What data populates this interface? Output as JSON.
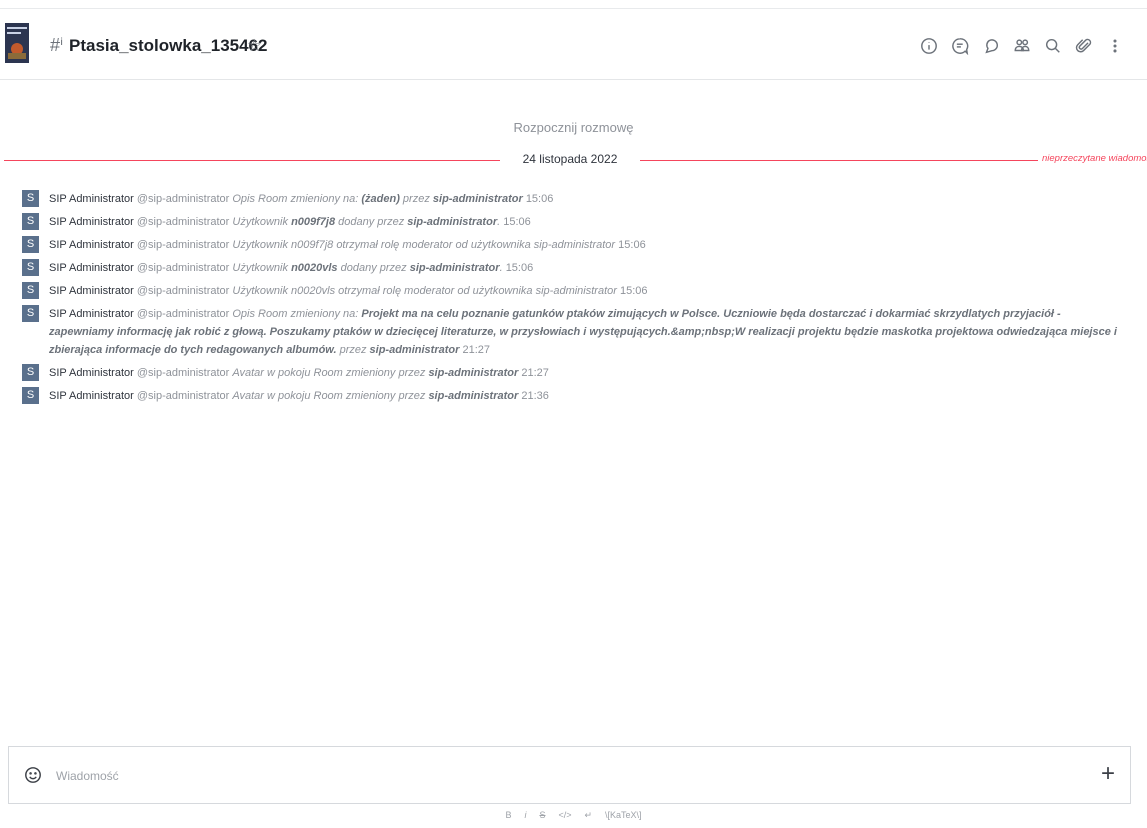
{
  "room": {
    "hash_icon": "#ⁱ",
    "name": "Ptasia_stolowka_135462",
    "star_icon": "☆"
  },
  "toolbar_icons": [
    "info-icon",
    "threads-icon",
    "discussion-icon",
    "members-icon",
    "search-icon",
    "attachment-icon",
    "kebab-icon"
  ],
  "start_conversation": "Rozpocznij rozmowę",
  "divider": {
    "date": "24 listopada 2022",
    "unread": "nieprzeczytane wiadomości"
  },
  "messages": [
    {
      "avatar": "S",
      "user": "SIP Administrator",
      "handle": "@sip-administrator",
      "parts": [
        {
          "t": "Opis Room zmieniony na: "
        },
        {
          "t": "(żaden)",
          "b": true
        },
        {
          "t": " przez "
        },
        {
          "t": "sip-administrator",
          "b": true
        }
      ],
      "time": "15:06"
    },
    {
      "avatar": "S",
      "user": "SIP Administrator",
      "handle": "@sip-administrator",
      "parts": [
        {
          "t": "Użytkownik "
        },
        {
          "t": "n009f7j8",
          "b": true
        },
        {
          "t": " dodany przez "
        },
        {
          "t": "sip-administrator",
          "b": true
        },
        {
          "t": "."
        }
      ],
      "time": "15:06"
    },
    {
      "avatar": "S",
      "user": "SIP Administrator",
      "handle": "@sip-administrator",
      "parts": [
        {
          "t": "Użytkownik n009f7j8 otrzymał rolę moderator od użytkownika sip-administrator"
        }
      ],
      "time": "15:06"
    },
    {
      "avatar": "S",
      "user": "SIP Administrator",
      "handle": "@sip-administrator",
      "parts": [
        {
          "t": "Użytkownik "
        },
        {
          "t": "n0020vls",
          "b": true
        },
        {
          "t": " dodany przez "
        },
        {
          "t": "sip-administrator",
          "b": true
        },
        {
          "t": "."
        }
      ],
      "time": "15:06"
    },
    {
      "avatar": "S",
      "user": "SIP Administrator",
      "handle": "@sip-administrator",
      "parts": [
        {
          "t": "Użytkownik n0020vls otrzymał rolę moderator od użytkownika sip-administrator"
        }
      ],
      "time": "15:06"
    },
    {
      "avatar": "S",
      "user": "SIP Administrator",
      "handle": "@sip-administrator",
      "parts": [
        {
          "t": "Opis Room zmieniony na: "
        },
        {
          "t": "Projekt ma na celu poznanie gatunków ptaków zimujących w Polsce. Uczniowie będa dostarczać i dokarmiać skrzydlatych przyjaciół - zapewniamy informację jak robić z głową. Poszukamy ptaków w dziecięcej literaturze, w przysłowiach i występujących.&amp;nbsp;W realizacji projektu będzie maskotka projektowa odwiedzająca miejsce i zbierająca informacje do tych redagowanych albumów.",
          "b": true
        },
        {
          "t": " przez "
        },
        {
          "t": "sip-administrator",
          "b": true
        }
      ],
      "time": "21:27"
    },
    {
      "avatar": "S",
      "user": "SIP Administrator",
      "handle": "@sip-administrator",
      "parts": [
        {
          "t": "Avatar w pokoju Room zmieniony przez "
        },
        {
          "t": "sip-administrator",
          "b": true
        }
      ],
      "time": "21:27"
    },
    {
      "avatar": "S",
      "user": "SIP Administrator",
      "handle": "@sip-administrator",
      "parts": [
        {
          "t": "Avatar w pokoju Room zmieniony przez "
        },
        {
          "t": "sip-administrator",
          "b": true
        }
      ],
      "time": "21:36"
    }
  ],
  "composer": {
    "placeholder": "Wiadomość",
    "emoji_icon": "emoji-icon",
    "plus_icon": "+"
  },
  "formatting": [
    "B",
    "i",
    "S",
    "</>",
    "↵",
    "\\[KaTeX\\]"
  ]
}
